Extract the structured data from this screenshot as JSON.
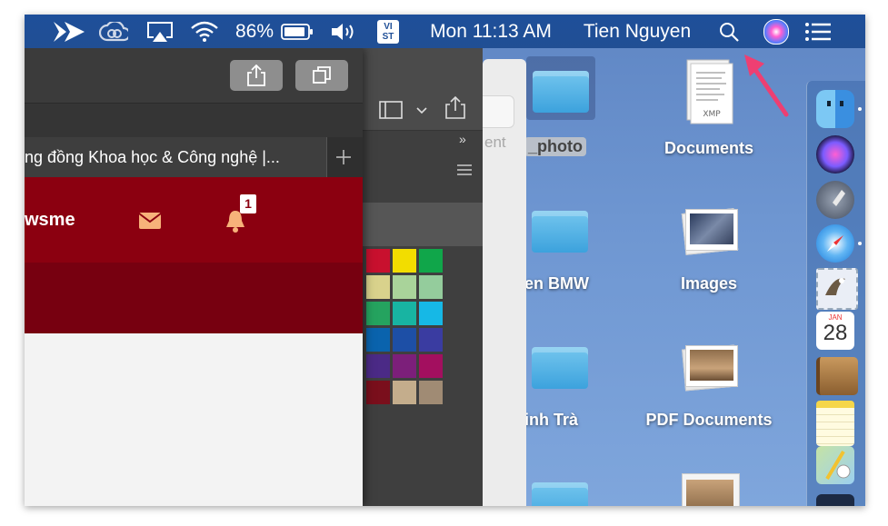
{
  "menubar": {
    "battery_percent": "86%",
    "input_source": "VI\nST",
    "input_source_top": "VI",
    "input_source_bottom": "ST",
    "datetime": "Mon 11:13 AM",
    "user": "Tien Nguyen"
  },
  "browser": {
    "tab_title": "ng đồng Khoa học & Công nghệ |...",
    "site_name": "wsme",
    "notification_count": "1"
  },
  "panel": {
    "overflow": "»"
  },
  "white_panel": {
    "hint_text": "ent"
  },
  "desktop": {
    "icons": [
      {
        "label": "_photo"
      },
      {
        "label": "Documents"
      },
      {
        "label": "en BMW"
      },
      {
        "label": "Images"
      },
      {
        "label": "inh Trà"
      },
      {
        "label": "PDF Documents"
      }
    ],
    "xmp_label": "XMP"
  },
  "dock": {
    "calendar_month": "JAN",
    "calendar_day": "28"
  },
  "colors": {
    "menubar": "#1f4f97",
    "site_red": "#8b0010",
    "annotation_arrow": "#ee3f72",
    "swatches": [
      "#c8102e",
      "#f2dd00",
      "#10a64a",
      "#d9d28c",
      "#a9d39a",
      "#94cc9c",
      "#25a35f",
      "#18b4a2",
      "#16b8e6",
      "#0a63ad",
      "#1d4fa6",
      "#3a3ca1",
      "#4b2a86",
      "#7c1f7a",
      "#a30f5f",
      "#7a0f1c",
      "#c4ad8c",
      "#a08b74"
    ]
  }
}
